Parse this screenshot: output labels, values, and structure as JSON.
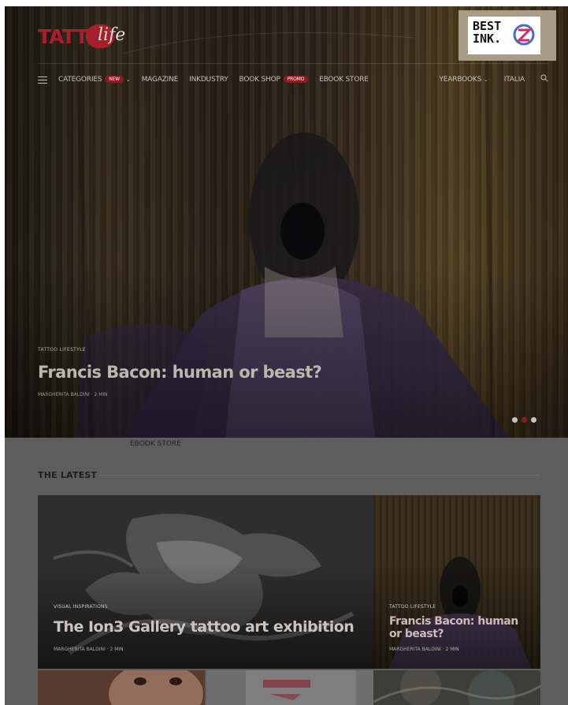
{
  "brand": {
    "logo_main": "TATT",
    "logo_script": "life"
  },
  "ad": {
    "line1": "BEST",
    "line2": "INK."
  },
  "nav": {
    "items": [
      {
        "label": "CATEGORIES",
        "badge": "NEW"
      },
      {
        "label": "MAGAZINE"
      },
      {
        "label": "INKDUSTRY"
      },
      {
        "label": "BOOK SHOP",
        "badge": "PROMO"
      },
      {
        "label": "EBOOK STORE"
      }
    ],
    "right": {
      "yearbooks": "YEARBOOKS",
      "language": "ITALIA"
    }
  },
  "hero": {
    "category": "TATTOO LIFESTYLE",
    "title": "Francis Bacon: human or beast?",
    "meta": "MARGHERITA BALDINI · 2 MIN"
  },
  "ebook_label": "EBOOK STORE",
  "latest": {
    "heading": "THE LATEST",
    "cards": [
      {
        "category": "VISUAL INSPIRATIONS",
        "title": "The Ion3 Gallery tattoo art exhibition",
        "meta": "MARGHERITA BALDINI · 2 MIN"
      },
      {
        "category": "TATTOO LIFESTYLE",
        "title": "Francis Bacon: human or beast?",
        "meta": "MARGHERITA BALDINI · 2 MIN"
      }
    ]
  },
  "colors": {
    "accent": "#8a1c24",
    "logo_red": "#a5202c"
  }
}
